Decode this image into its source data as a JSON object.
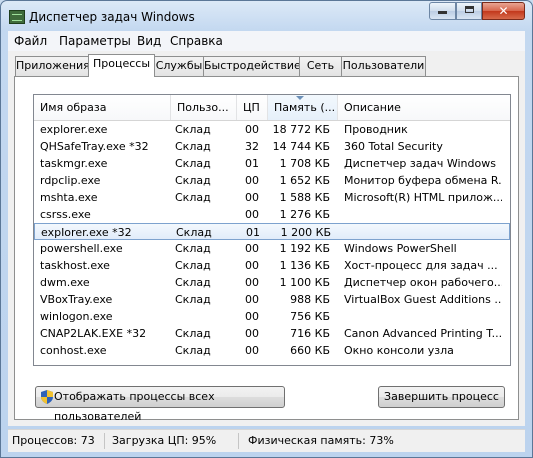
{
  "window": {
    "title": "Диспетчер задач Windows",
    "minimize_icon": "minimize-icon",
    "maximize_icon": "maximize-icon",
    "close_icon": "close-icon",
    "close_glyph": "✕"
  },
  "menu": {
    "items": [
      {
        "label": "Файл"
      },
      {
        "label": "Параметры"
      },
      {
        "label": "Вид"
      },
      {
        "label": "Справка"
      }
    ]
  },
  "tabs": [
    {
      "label": "Приложения"
    },
    {
      "label": "Процессы",
      "active": true
    },
    {
      "label": "Службы"
    },
    {
      "label": "Быстродействие"
    },
    {
      "label": "Сеть"
    },
    {
      "label": "Пользователи"
    }
  ],
  "table": {
    "columns": [
      "Имя образа",
      "Пользо...",
      "ЦП",
      "Память (...",
      "Описание"
    ],
    "sorted_column": "Память (...",
    "rows": [
      {
        "name": "explorer.exe",
        "user": "Склад",
        "cpu": "00",
        "mem": "18 772 КБ",
        "desc": "Проводник"
      },
      {
        "name": "QHSafeTray.exe *32",
        "user": "Склад",
        "cpu": "32",
        "mem": "14 744 КБ",
        "desc": "360 Total Security"
      },
      {
        "name": "taskmgr.exe",
        "user": "Склад",
        "cpu": "01",
        "mem": "1 708 КБ",
        "desc": "Диспетчер задач Windows"
      },
      {
        "name": "rdpclip.exe",
        "user": "Склад",
        "cpu": "00",
        "mem": "1 652 КБ",
        "desc": "Монитор буфера обмена R..."
      },
      {
        "name": "mshta.exe",
        "user": "Склад",
        "cpu": "00",
        "mem": "1 588 КБ",
        "desc": "Microsoft(R) HTML прилож..."
      },
      {
        "name": "csrss.exe",
        "user": "",
        "cpu": "00",
        "mem": "1 276 КБ",
        "desc": ""
      },
      {
        "name": "expIorer.exe *32",
        "user": "Склад",
        "cpu": "01",
        "mem": "1 200 КБ",
        "desc": "",
        "selected": true
      },
      {
        "name": "powershell.exe",
        "user": "Склад",
        "cpu": "00",
        "mem": "1 192 КБ",
        "desc": "Windows PowerShell"
      },
      {
        "name": "taskhost.exe",
        "user": "Склад",
        "cpu": "00",
        "mem": "1 136 КБ",
        "desc": "Хост-процесс для задач ..."
      },
      {
        "name": "dwm.exe",
        "user": "Склад",
        "cpu": "00",
        "mem": "1 100 КБ",
        "desc": "Диспетчер окон рабочего..."
      },
      {
        "name": "VBoxTray.exe",
        "user": "Склад",
        "cpu": "00",
        "mem": "988 КБ",
        "desc": "VirtualBox Guest Additions ..."
      },
      {
        "name": "winlogon.exe",
        "user": "",
        "cpu": "00",
        "mem": "756 КБ",
        "desc": ""
      },
      {
        "name": "CNAP2LAK.EXE *32",
        "user": "Склад",
        "cpu": "00",
        "mem": "716 КБ",
        "desc": "Canon Advanced Printing T..."
      },
      {
        "name": "conhost.exe",
        "user": "Склад",
        "cpu": "00",
        "mem": "660 КБ",
        "desc": "Окно консоли узла"
      }
    ]
  },
  "buttons": {
    "show_all": "Отображать процессы всех пользователей",
    "show_all_icon": "uac-shield-icon",
    "end_process": "Завершить процесс"
  },
  "status": {
    "processes": "Процессов: 73",
    "cpu": "Загрузка ЦП: 95%",
    "memory": "Физическая память: 73%"
  }
}
